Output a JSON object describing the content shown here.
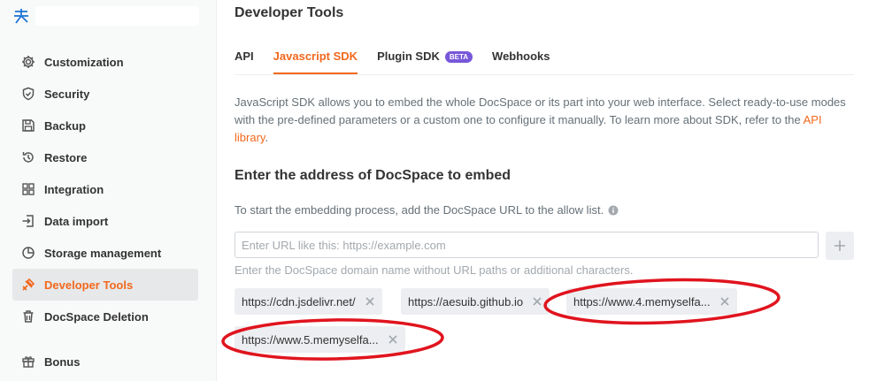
{
  "sidebar": {
    "items": [
      {
        "label": "Customization",
        "icon": "gear-icon"
      },
      {
        "label": "Security",
        "icon": "shield-icon"
      },
      {
        "label": "Backup",
        "icon": "floppy-icon"
      },
      {
        "label": "Restore",
        "icon": "restore-icon"
      },
      {
        "label": "Integration",
        "icon": "grid-icon"
      },
      {
        "label": "Data import",
        "icon": "import-icon"
      },
      {
        "label": "Storage management",
        "icon": "pie-icon"
      },
      {
        "label": "Developer Tools",
        "icon": "developer-tools-icon",
        "active": true
      },
      {
        "label": "DocSpace Deletion",
        "icon": "trash-icon"
      }
    ],
    "bonus": {
      "label": "Bonus",
      "icon": "gift-icon"
    }
  },
  "page": {
    "title": "Developer Tools",
    "tabs": [
      {
        "label": "API"
      },
      {
        "label": "Javascript SDK",
        "active": true
      },
      {
        "label": "Plugin SDK",
        "badge": "BETA"
      },
      {
        "label": "Webhooks"
      }
    ],
    "description_pre": "JavaScript SDK allows you to embed the whole DocSpace or its part into your web interface. Select ready-to-use modes with the pre-defined parameters or a custom one to configure it manually. To learn more about SDK, refer to the ",
    "description_link": "API library",
    "description_post": ".",
    "section_title": "Enter the address of DocSpace to embed",
    "hint": "To start the embedding process, add the DocSpace URL to the allow list.",
    "url_input": {
      "placeholder": "Enter URL like this: https://example.com",
      "value": ""
    },
    "domain_note": "Enter the DocSpace domain name without URL paths or additional characters.",
    "allowed_urls": [
      "https://cdn.jsdelivr.net/",
      "https://aesuib.github.io",
      "https://www.4.memyselfa...",
      "https://www.5.memyselfa..."
    ]
  },
  "colors": {
    "accent": "#f2681d",
    "beta_badge": "#7757d9",
    "annotation": "#e0141e"
  }
}
